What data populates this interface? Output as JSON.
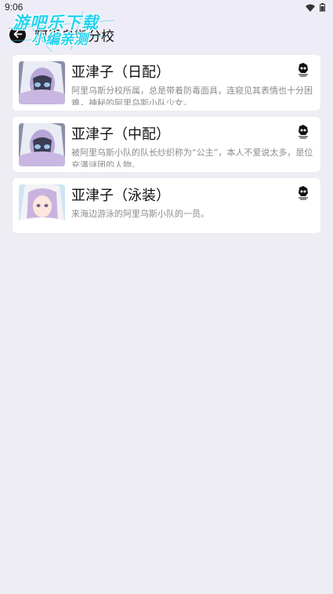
{
  "status_bar": {
    "time": "9:06"
  },
  "header": {
    "title": "阿里乌斯分校"
  },
  "watermark": {
    "line1": "游吧乐下载",
    "line2": "小编亲测"
  },
  "characters": [
    {
      "name": "亚津子（日配）",
      "description": "阿里乌斯分校所属，总是带着防毒面具，连窥见其表情也十分困难，神秘的阿里乌斯小队少女。"
    },
    {
      "name": "亚津子（中配）",
      "description": "被阿里乌斯小队的队长纱织称为“公主”，本人不爱说太多，是位充满谜团的人物。"
    },
    {
      "name": "亚津子（泳装）",
      "description": "来海边游泳的阿里乌斯小队的一员。"
    }
  ],
  "colors": {
    "background": "#eeedf3",
    "header_bg": "#eeedf7",
    "card_bg": "#ffffff",
    "watermark": "#25d3ee"
  },
  "icons": {
    "back": "arrow-left-icon",
    "wifi": "wifi-icon",
    "battery": "battery-icon",
    "badge": "character-badge-icon"
  }
}
